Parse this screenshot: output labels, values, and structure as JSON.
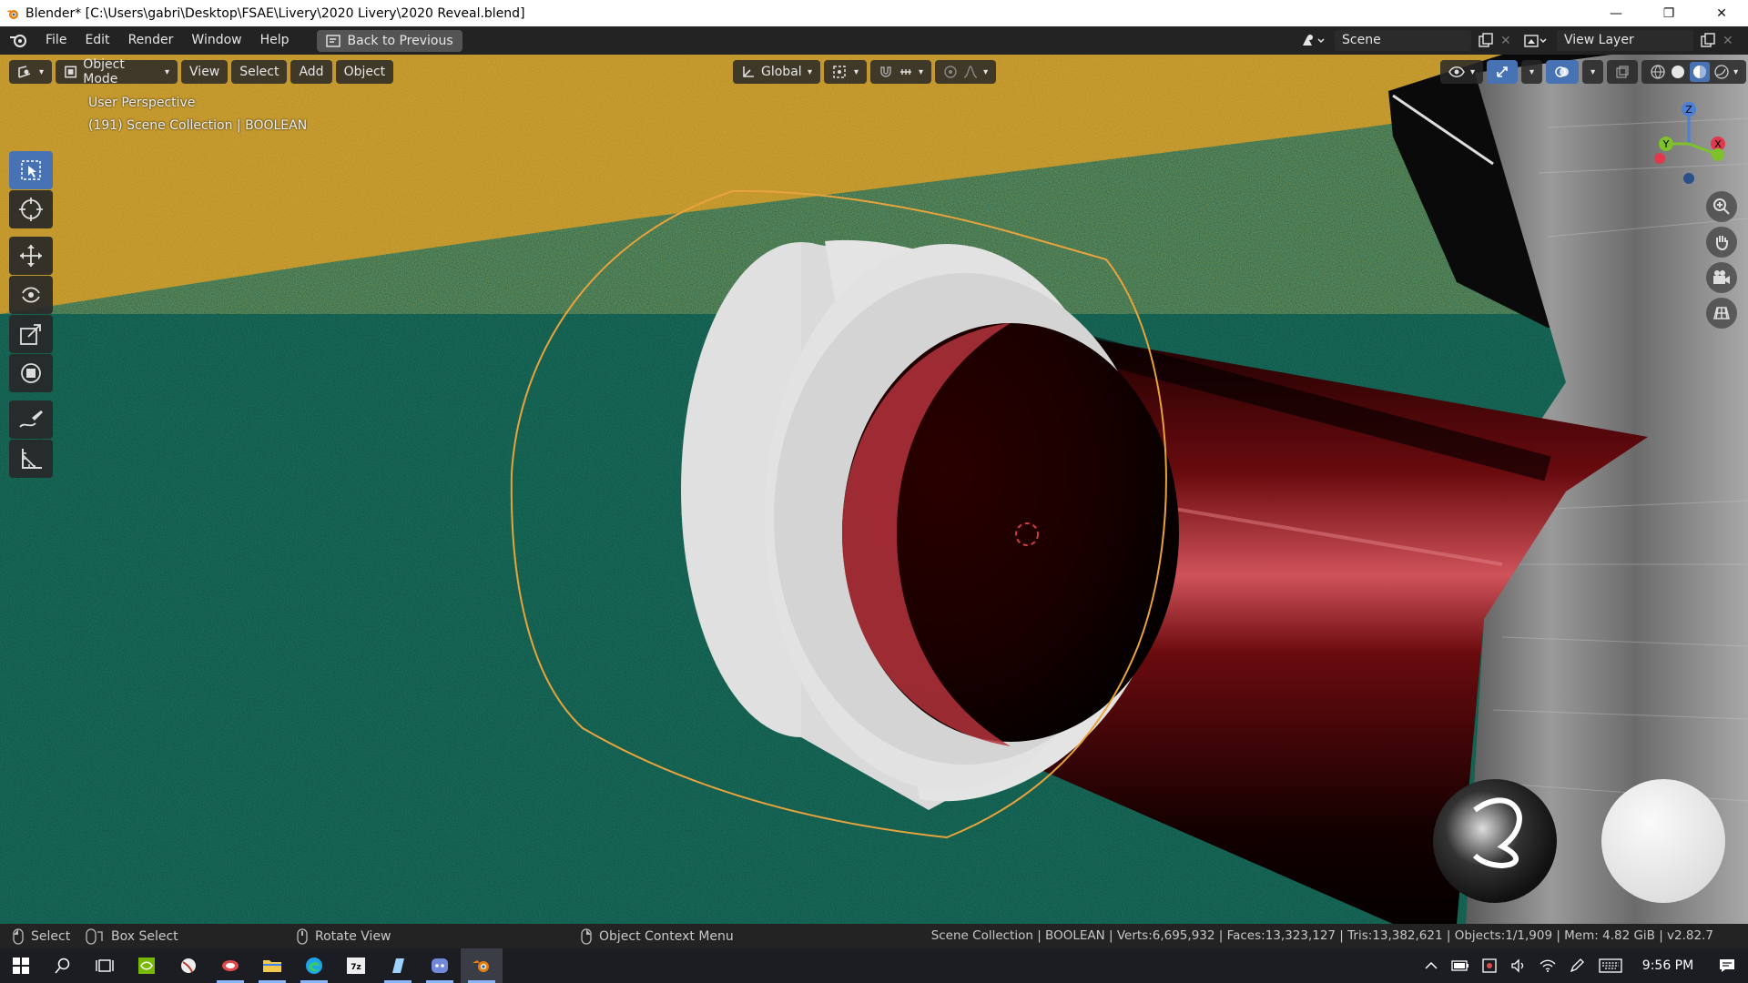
{
  "window": {
    "title": "Blender* [C:\\Users\\gabri\\Desktop\\FSAE\\Livery\\2020 Livery\\2020 Reveal.blend]",
    "minimize": "—",
    "maximize": "❐",
    "close": "✕"
  },
  "menu": {
    "items": [
      "File",
      "Edit",
      "Render",
      "Window",
      "Help"
    ],
    "back_button": "Back to Previous",
    "scene_label": "Scene",
    "view_layer_label": "View Layer"
  },
  "viewport_header": {
    "mode": "Object Mode",
    "menus": [
      "View",
      "Select",
      "Add",
      "Object"
    ],
    "transform_orientation": "Global"
  },
  "overlay": {
    "perspective": "User Perspective",
    "collection": "(191) Scene Collection | BOOLEAN"
  },
  "gizmo": {
    "z": "Z",
    "y": "Y",
    "x": "X"
  },
  "tools": [
    "select-box",
    "cursor",
    "move",
    "rotate",
    "scale",
    "transform",
    "annotate",
    "measure"
  ],
  "status": {
    "select": "Select",
    "box_select": "Box Select",
    "rotate_view": "Rotate View",
    "context_menu": "Object Context Menu",
    "stats": "Scene Collection | BOOLEAN | Verts:6,695,932 | Faces:13,323,127 | Tris:13,382,621 | Objects:1/1,909 | Mem: 4.82 GiB | v2.82.7"
  },
  "taskbar": {
    "time": "9:56 PM"
  },
  "colors": {
    "accent": "#4772b3",
    "selection_outline": "#e8a33d",
    "background_yellow": "#b8881d",
    "background_green": "#0d5040"
  }
}
